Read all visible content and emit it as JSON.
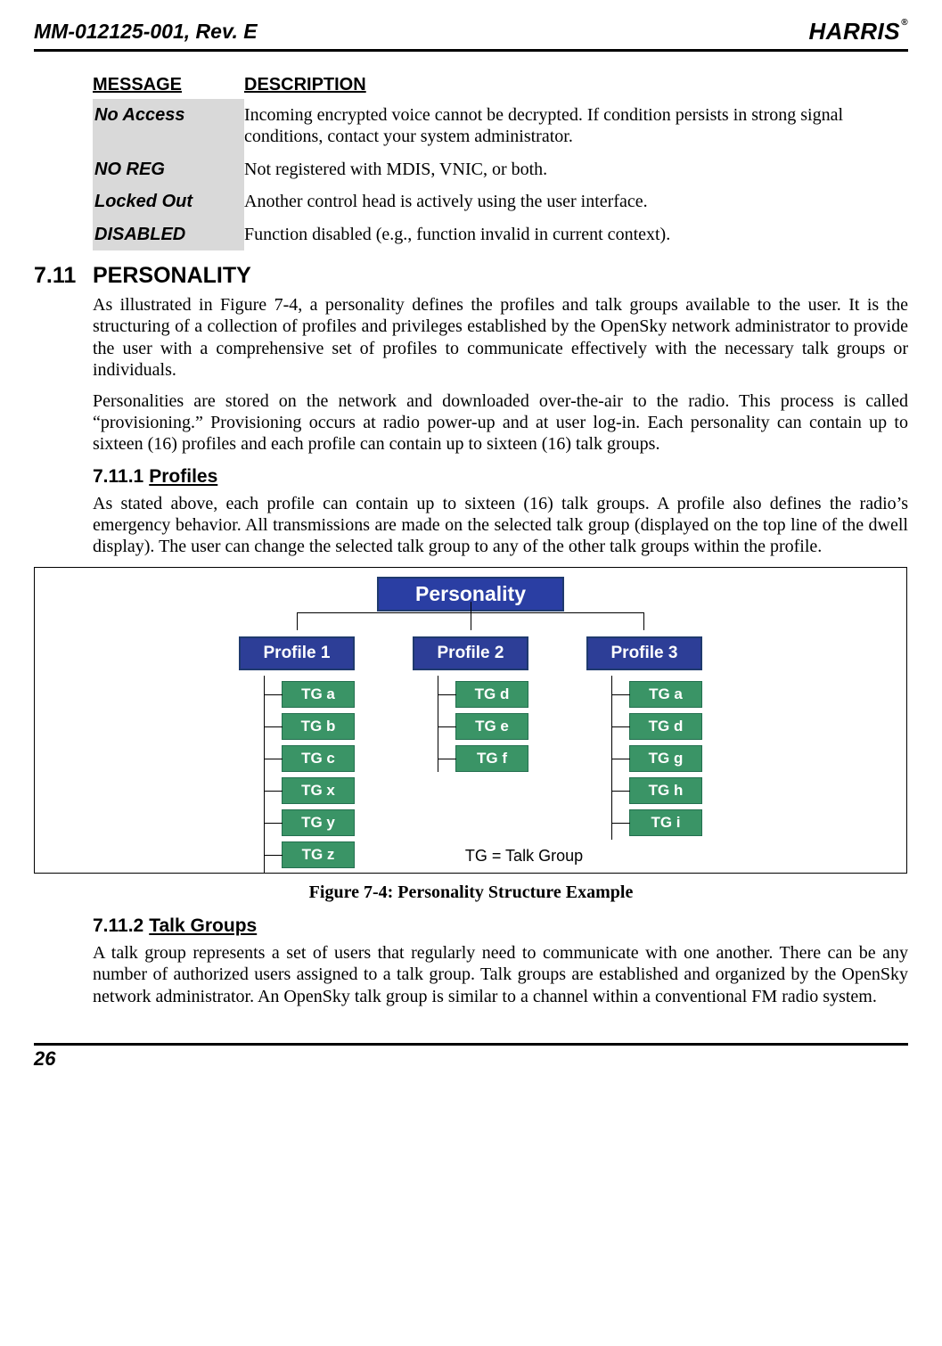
{
  "header": {
    "docnum": "MM-012125-001, Rev. E",
    "logo": "HARRIS",
    "logo_reg": "®"
  },
  "table": {
    "col1": "MESSAGE",
    "col2": "DESCRIPTION",
    "rows": [
      {
        "m": "No Access",
        "d": "Incoming encrypted voice cannot be decrypted. If condition persists in strong signal conditions, contact your system administrator."
      },
      {
        "m": "NO REG",
        "d": "Not registered with MDIS, VNIC, or both."
      },
      {
        "m": "Locked Out",
        "d": "Another control head is actively using the user interface."
      },
      {
        "m": "DISABLED",
        "d": "Function disabled (e.g., function invalid in current context)."
      }
    ]
  },
  "s711": {
    "num": "7.11",
    "title": "PERSONALITY",
    "p1": "As illustrated in Figure 7-4, a personality defines the profiles and talk groups available to the user. It is the structuring of a collection of profiles and privileges established by the OpenSky network administrator to provide the user with a comprehensive set of profiles to communicate effectively with the necessary talk groups or individuals.",
    "p2": "Personalities are stored on the network and downloaded over-the-air to the radio. This process is called “provisioning.” Provisioning occurs at radio power-up and at user log-in. Each personality can contain up to sixteen (16) profiles and each profile can contain up to sixteen (16) talk groups."
  },
  "s7111": {
    "num": "7.11.1",
    "title": "Profiles",
    "p1": "As stated above, each profile can contain up to sixteen (16) talk groups. A profile also defines the radio’s emergency behavior. All transmissions are made on the selected talk group (displayed on the top line of the dwell display). The user can change the selected talk group to any of the other talk groups within the profile."
  },
  "chart_data": {
    "type": "tree",
    "root": "Personality",
    "profiles": [
      {
        "name": "Profile 1",
        "tgs": [
          "TG a",
          "TG b",
          "TG c",
          "TG x",
          "TG y",
          "TG z"
        ]
      },
      {
        "name": "Profile 2",
        "tgs": [
          "TG d",
          "TG e",
          "TG f"
        ]
      },
      {
        "name": "Profile 3",
        "tgs": [
          "TG a",
          "TG d",
          "TG g",
          "TG h",
          "TG i"
        ]
      }
    ],
    "legend": "TG = Talk Group",
    "caption": "Figure 7-4: Personality Structure Example"
  },
  "s7112": {
    "num": "7.11.2",
    "title": "Talk Groups",
    "p1": "A talk group represents a set of users that regularly need to communicate with one another. There can be any number of authorized users assigned to a talk group. Talk groups are established and organized by the OpenSky network administrator. An OpenSky talk group is similar to a channel within a conventional FM radio system."
  },
  "footer": {
    "page": "26"
  }
}
